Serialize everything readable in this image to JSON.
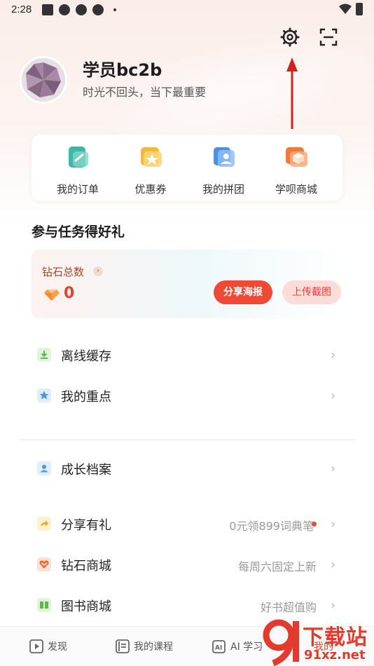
{
  "status_bar": {
    "time": "2:28"
  },
  "profile": {
    "name": "学员bc2b",
    "motto": "时光不回头，当下最重要"
  },
  "header": {
    "settings_icon": "gear-icon",
    "scan_icon": "scan-icon"
  },
  "quick_menu": [
    {
      "label": "我的订单",
      "icon": "order-icon",
      "color": "#3fb6a8"
    },
    {
      "label": "优惠券",
      "icon": "coupon-icon",
      "color": "#f5b93a"
    },
    {
      "label": "我的拼团",
      "icon": "group-icon",
      "color": "#4a8fe8"
    },
    {
      "label": "学呗商城",
      "icon": "shop-icon",
      "color": "#f07a3a"
    }
  ],
  "tasks": {
    "title": "参与任务得好礼",
    "diamond_title": "钻石总数",
    "diamond_chevron": "›",
    "diamond_value": "0",
    "share_button": "分享海报",
    "upload_button": "上传截图"
  },
  "list_group_1": [
    {
      "label": "离线缓存",
      "icon": "download-icon",
      "color": "#6dc45a"
    },
    {
      "label": "我的重点",
      "icon": "star-icon",
      "color": "#5aa3e8"
    }
  ],
  "list_group_2": [
    {
      "label": "成长档案",
      "icon": "profile-icon",
      "color": "#5aa3e8"
    }
  ],
  "list_group_3": [
    {
      "label": "分享有礼",
      "icon": "share-icon",
      "color": "#f5b93a",
      "value": "0元领899词典笔",
      "dot": true
    },
    {
      "label": "钻石商城",
      "icon": "diamond-icon",
      "color": "#f07a3a",
      "value": "每周六固定上新"
    },
    {
      "label": "图书商城",
      "icon": "book-icon",
      "color": "#6dc45a",
      "value": "好书超值购"
    }
  ],
  "chevron": "›",
  "bottom_nav": [
    {
      "label": "发现",
      "icon": "discover-icon"
    },
    {
      "label": "我的课程",
      "icon": "course-icon"
    },
    {
      "label": "AI 学习",
      "icon": "ai-icon"
    },
    {
      "label": "我的",
      "icon": "me-icon"
    }
  ],
  "watermark": {
    "big": "下载站",
    "small": "91xz.net"
  }
}
